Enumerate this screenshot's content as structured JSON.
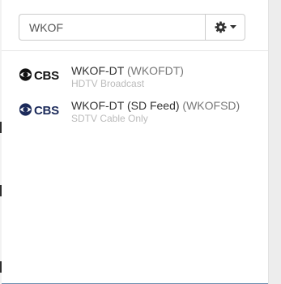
{
  "search": {
    "value": "WKOF",
    "placeholder": ""
  },
  "settings_button": {
    "icon": "gear-icon",
    "caret_icon": "caret-down-icon"
  },
  "results": [
    {
      "network": "CBS",
      "network_icon": "cbs-eye-icon",
      "logo_color": "#111111",
      "title": "WKOF-DT",
      "callsign": "(WKOFDT)",
      "subtitle": "HDTV Broadcast"
    },
    {
      "network": "CBS",
      "network_icon": "cbs-eye-icon",
      "logo_color": "#1b2a5a",
      "title": "WKOF-DT (SD Feed)",
      "callsign": "(WKOFSD)",
      "subtitle": "SDTV Cable Only"
    }
  ],
  "colors": {
    "border": "#cccccc",
    "subtitle": "#bbbbbb",
    "callsign": "#777777",
    "scrollbar": "#ededed"
  }
}
